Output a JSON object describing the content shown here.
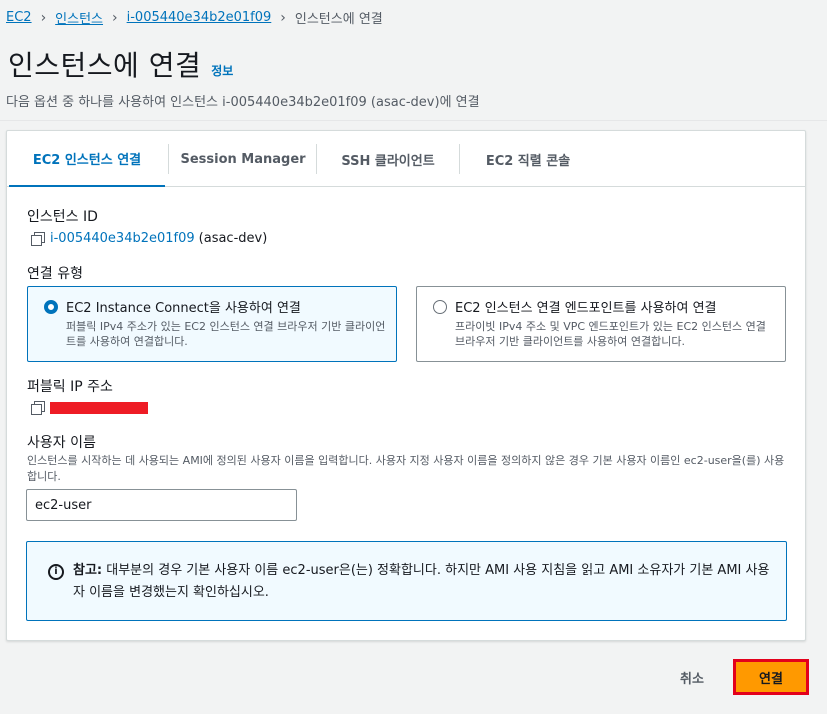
{
  "breadcrumb": {
    "items": [
      "EC2",
      "인스턴스",
      "i-005440e34b2e01f09"
    ],
    "current": "인스턴스에 연결"
  },
  "header": {
    "title": "인스턴스에 연결",
    "info_link": "정보",
    "subtitle": "다음 옵션 중 하나를 사용하여 인스턴스 i-005440e34b2e01f09 (asac-dev)에 연결"
  },
  "tabs": [
    {
      "label": "EC2 인스턴스 연결",
      "active": true
    },
    {
      "label": "Session Manager",
      "active": false
    },
    {
      "label": "SSH 클라이언트",
      "active": false
    },
    {
      "label": "EC2 직렬 콘솔",
      "active": false
    }
  ],
  "instance": {
    "label": "인스턴스 ID",
    "id": "i-005440e34b2e01f09",
    "name": "(asac-dev)"
  },
  "connection_type": {
    "label": "연결 유형",
    "options": [
      {
        "title": "EC2 Instance Connect을 사용하여 연결",
        "desc": "퍼블릭 IPv4 주소가 있는 EC2 인스턴스 연결 브라우저 기반 클라이언트를 사용하여 연결합니다.",
        "selected": true
      },
      {
        "title": "EC2 인스턴스 연결 엔드포인트를 사용하여 연결",
        "desc": "프라이빗 IPv4 주소 및 VPC 엔드포인트가 있는 EC2 인스턴스 연결 브라우저 기반 클라이언트를 사용하여 연결합니다.",
        "selected": false
      }
    ]
  },
  "public_ip": {
    "label": "퍼블릭 IP 주소"
  },
  "username": {
    "label": "사용자 이름",
    "helper": "인스턴스를 시작하는 데 사용되는 AMI에 정의된 사용자 이름을 입력합니다. 사용자 지정 사용자 이름을 정의하지 않은 경우 기본 사용자 이름인 ec2-user을(를) 사용합니다.",
    "value": "ec2-user"
  },
  "alert": {
    "strong": "참고:",
    "text": " 대부분의 경우 기본 사용자 이름 ec2-user은(는) 정확합니다. 하지만 AMI 사용 지침을 읽고 AMI 소유자가 기본 AMI 사용자 이름을 변경했는지 확인하십시오."
  },
  "footer": {
    "cancel_label": "취소",
    "connect_label": "연결"
  },
  "colors": {
    "link": "#0073bb",
    "primary_button": "#ff9900",
    "highlight_border": "#e3001b",
    "redaction": "#ee1c25"
  }
}
